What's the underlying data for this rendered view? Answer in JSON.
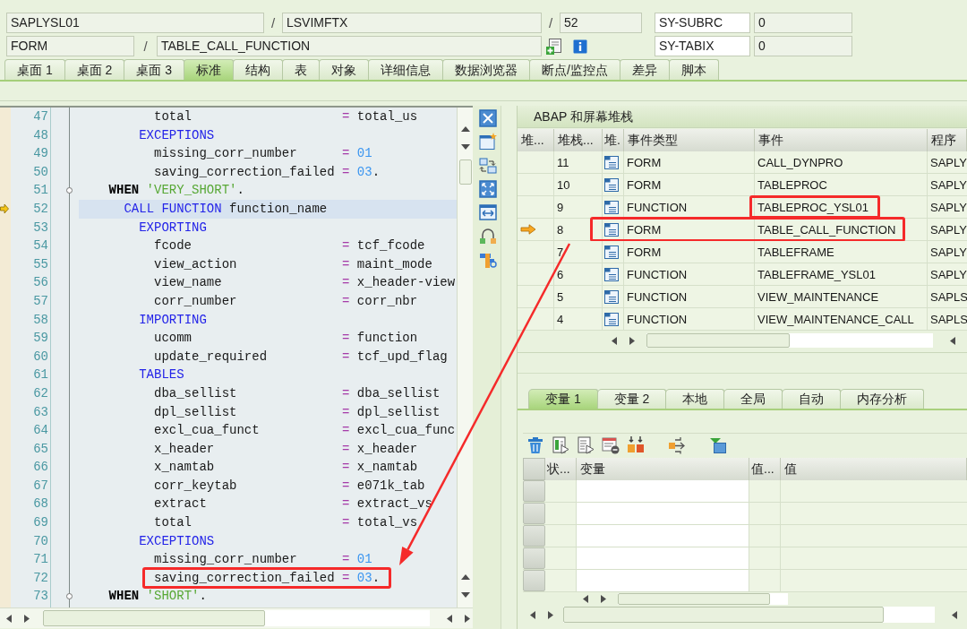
{
  "header": {
    "row_1": [
      {
        "kind": "field",
        "text": "SAPLYSL01"
      },
      {
        "kind": "separator",
        "text": "/"
      },
      {
        "kind": "field",
        "text": "LSVIMFTX"
      },
      {
        "kind": "separator",
        "text": "/"
      },
      {
        "kind": "field",
        "text": "52"
      }
    ],
    "row_2": [
      {
        "kind": "field",
        "text": "FORM"
      },
      {
        "kind": "separator",
        "text": "/"
      },
      {
        "kind": "field",
        "text": "TABLE_CALL_FUNCTION"
      }
    ],
    "system_fields": [
      {
        "name": "SY-SUBRC",
        "value": "0"
      },
      {
        "name": "SY-TABIX",
        "value": "0"
      }
    ]
  },
  "tabs": [
    {
      "label": "桌面 1",
      "selected": false
    },
    {
      "label": "桌面 2",
      "selected": false
    },
    {
      "label": "桌面 3",
      "selected": false
    },
    {
      "label": "标准",
      "selected": true
    },
    {
      "label": "结构",
      "selected": false
    },
    {
      "label": "表",
      "selected": false
    },
    {
      "label": "对象",
      "selected": false
    },
    {
      "label": "详细信息",
      "selected": false
    },
    {
      "label": "数据浏览器",
      "selected": false
    },
    {
      "label": "断点/监控点",
      "selected": false
    },
    {
      "label": "差异",
      "selected": false
    },
    {
      "label": "脚本",
      "selected": false
    }
  ],
  "code_editor": {
    "lines": [
      {
        "number": "47",
        "current": false,
        "fold": false,
        "annotated": false,
        "segments": [
          {
            "kind": "plain",
            "text": "          total                    "
          },
          {
            "kind": "operator",
            "text": "="
          },
          {
            "kind": "plain",
            "text": " total_us"
          }
        ]
      },
      {
        "number": "48",
        "current": false,
        "fold": false,
        "annotated": false,
        "segments": [
          {
            "kind": "keyword",
            "text": "        EXCEPTIONS"
          }
        ]
      },
      {
        "number": "49",
        "current": false,
        "fold": false,
        "annotated": false,
        "segments": [
          {
            "kind": "plain",
            "text": "          missing_corr_number      "
          },
          {
            "kind": "operator",
            "text": "="
          },
          {
            "kind": "number",
            "text": " 01"
          }
        ]
      },
      {
        "number": "50",
        "current": false,
        "fold": false,
        "annotated": false,
        "segments": [
          {
            "kind": "plain",
            "text": "          saving_correction_failed "
          },
          {
            "kind": "operator",
            "text": "="
          },
          {
            "kind": "number",
            "text": " 03"
          },
          {
            "kind": "plain",
            "text": "."
          }
        ]
      },
      {
        "number": "51",
        "current": false,
        "fold": true,
        "annotated": false,
        "segments": [
          {
            "kind": "bold",
            "text": "    WHEN"
          },
          {
            "kind": "string",
            "text": " 'VERY_SHORT'"
          },
          {
            "kind": "plain",
            "text": "."
          }
        ]
      },
      {
        "number": "52",
        "current": true,
        "fold": false,
        "annotated": false,
        "segments": [
          {
            "kind": "keyword",
            "text": "      CALL FUNCTION"
          },
          {
            "kind": "plain",
            "text": " function_name"
          }
        ]
      },
      {
        "number": "53",
        "current": false,
        "fold": false,
        "annotated": false,
        "segments": [
          {
            "kind": "keyword",
            "text": "        EXPORTING"
          }
        ]
      },
      {
        "number": "54",
        "current": false,
        "fold": false,
        "annotated": false,
        "segments": [
          {
            "kind": "plain",
            "text": "          fcode                    "
          },
          {
            "kind": "operator",
            "text": "="
          },
          {
            "kind": "plain",
            "text": " tcf_fcode"
          }
        ]
      },
      {
        "number": "55",
        "current": false,
        "fold": false,
        "annotated": false,
        "segments": [
          {
            "kind": "plain",
            "text": "          view_action              "
          },
          {
            "kind": "operator",
            "text": "="
          },
          {
            "kind": "plain",
            "text": " maint_mode"
          }
        ]
      },
      {
        "number": "56",
        "current": false,
        "fold": false,
        "annotated": false,
        "segments": [
          {
            "kind": "plain",
            "text": "          view_name                "
          },
          {
            "kind": "operator",
            "text": "="
          },
          {
            "kind": "plain",
            "text": " x_header-view"
          }
        ]
      },
      {
        "number": "57",
        "current": false,
        "fold": false,
        "annotated": false,
        "segments": [
          {
            "kind": "plain",
            "text": "          corr_number              "
          },
          {
            "kind": "operator",
            "text": "="
          },
          {
            "kind": "plain",
            "text": " corr_nbr"
          }
        ]
      },
      {
        "number": "58",
        "current": false,
        "fold": false,
        "annotated": false,
        "segments": [
          {
            "kind": "keyword",
            "text": "        IMPORTING"
          }
        ]
      },
      {
        "number": "59",
        "current": false,
        "fold": false,
        "annotated": false,
        "segments": [
          {
            "kind": "plain",
            "text": "          ucomm                    "
          },
          {
            "kind": "operator",
            "text": "="
          },
          {
            "kind": "plain",
            "text": " function"
          }
        ]
      },
      {
        "number": "60",
        "current": false,
        "fold": false,
        "annotated": false,
        "segments": [
          {
            "kind": "plain",
            "text": "          update_required          "
          },
          {
            "kind": "operator",
            "text": "="
          },
          {
            "kind": "plain",
            "text": " tcf_upd_flag"
          }
        ]
      },
      {
        "number": "61",
        "current": false,
        "fold": false,
        "annotated": false,
        "segments": [
          {
            "kind": "keyword",
            "text": "        TABLES"
          }
        ]
      },
      {
        "number": "62",
        "current": false,
        "fold": false,
        "annotated": false,
        "segments": [
          {
            "kind": "plain",
            "text": "          dba_sellist              "
          },
          {
            "kind": "operator",
            "text": "="
          },
          {
            "kind": "plain",
            "text": " dba_sellist"
          }
        ]
      },
      {
        "number": "63",
        "current": false,
        "fold": false,
        "annotated": false,
        "segments": [
          {
            "kind": "plain",
            "text": "          dpl_sellist              "
          },
          {
            "kind": "operator",
            "text": "="
          },
          {
            "kind": "plain",
            "text": " dpl_sellist"
          }
        ]
      },
      {
        "number": "64",
        "current": false,
        "fold": false,
        "annotated": false,
        "segments": [
          {
            "kind": "plain",
            "text": "          excl_cua_funct           "
          },
          {
            "kind": "operator",
            "text": "="
          },
          {
            "kind": "plain",
            "text": " excl_cua_func"
          }
        ]
      },
      {
        "number": "65",
        "current": false,
        "fold": false,
        "annotated": false,
        "segments": [
          {
            "kind": "plain",
            "text": "          x_header                 "
          },
          {
            "kind": "operator",
            "text": "="
          },
          {
            "kind": "plain",
            "text": " x_header"
          }
        ]
      },
      {
        "number": "66",
        "current": false,
        "fold": false,
        "annotated": false,
        "segments": [
          {
            "kind": "plain",
            "text": "          x_namtab                 "
          },
          {
            "kind": "operator",
            "text": "="
          },
          {
            "kind": "plain",
            "text": " x_namtab"
          }
        ]
      },
      {
        "number": "67",
        "current": false,
        "fold": false,
        "annotated": false,
        "segments": [
          {
            "kind": "plain",
            "text": "          corr_keytab              "
          },
          {
            "kind": "operator",
            "text": "="
          },
          {
            "kind": "plain",
            "text": " e071k_tab"
          }
        ]
      },
      {
        "number": "68",
        "current": false,
        "fold": false,
        "annotated": false,
        "segments": [
          {
            "kind": "plain",
            "text": "          extract                  "
          },
          {
            "kind": "operator",
            "text": "="
          },
          {
            "kind": "plain",
            "text": " extract_vs"
          }
        ]
      },
      {
        "number": "69",
        "current": false,
        "fold": false,
        "annotated": false,
        "segments": [
          {
            "kind": "plain",
            "text": "          total                    "
          },
          {
            "kind": "operator",
            "text": "="
          },
          {
            "kind": "plain",
            "text": " total_vs"
          }
        ]
      },
      {
        "number": "70",
        "current": false,
        "fold": false,
        "annotated": false,
        "segments": [
          {
            "kind": "keyword",
            "text": "        EXCEPTIONS"
          }
        ]
      },
      {
        "number": "71",
        "current": false,
        "fold": false,
        "annotated": false,
        "segments": [
          {
            "kind": "plain",
            "text": "          missing_corr_number      "
          },
          {
            "kind": "operator",
            "text": "="
          },
          {
            "kind": "number",
            "text": " 01"
          }
        ]
      },
      {
        "number": "72",
        "current": false,
        "fold": false,
        "annotated": true,
        "segments": [
          {
            "kind": "plain",
            "text": "          saving_correction_failed "
          },
          {
            "kind": "operator",
            "text": "="
          },
          {
            "kind": "number",
            "text": " 03"
          },
          {
            "kind": "plain",
            "text": "."
          }
        ]
      },
      {
        "number": "73",
        "current": false,
        "fold": true,
        "annotated": false,
        "segments": [
          {
            "kind": "bold",
            "text": "    WHEN"
          },
          {
            "kind": "string",
            "text": " 'SHORT'"
          },
          {
            "kind": "plain",
            "text": "."
          }
        ]
      }
    ]
  },
  "stack_panel": {
    "title": "ABAP 和屏幕堆栈",
    "columns": [
      "堆...",
      "堆栈...",
      "堆.",
      "事件类型",
      "事件",
      "程序"
    ],
    "rows": [
      {
        "current": false,
        "type_annotated": false,
        "event_annotated": false,
        "number": "11",
        "type": "FORM",
        "event": "CALL_DYNPRO",
        "program": "SAPLY"
      },
      {
        "current": false,
        "type_annotated": false,
        "event_annotated": false,
        "number": "10",
        "type": "FORM",
        "event": "TABLEPROC",
        "program": "SAPLY"
      },
      {
        "current": false,
        "type_annotated": false,
        "event_annotated": true,
        "number": "9",
        "type": "FUNCTION",
        "event": "TABLEPROC_YSL01",
        "program": "SAPLY"
      },
      {
        "current": true,
        "type_annotated": true,
        "event_annotated": true,
        "number": "8",
        "type": "FORM",
        "event": "TABLE_CALL_FUNCTION",
        "program": "SAPLY"
      },
      {
        "current": false,
        "type_annotated": false,
        "event_annotated": false,
        "number": "7",
        "type": "FORM",
        "event": "TABLEFRAME",
        "program": "SAPLY"
      },
      {
        "current": false,
        "type_annotated": false,
        "event_annotated": false,
        "number": "6",
        "type": "FUNCTION",
        "event": "TABLEFRAME_YSL01",
        "program": "SAPLY"
      },
      {
        "current": false,
        "type_annotated": false,
        "event_annotated": false,
        "number": "5",
        "type": "FUNCTION",
        "event": "VIEW_MAINTENANCE",
        "program": "SAPLS"
      },
      {
        "current": false,
        "type_annotated": false,
        "event_annotated": false,
        "number": "4",
        "type": "FUNCTION",
        "event": "VIEW_MAINTENANCE_CALL",
        "program": "SAPLS"
      }
    ]
  },
  "variables_panel": {
    "tabs": [
      {
        "label": "变量 1",
        "selected": true
      },
      {
        "label": "变量 2",
        "selected": false
      },
      {
        "label": "本地",
        "selected": false
      },
      {
        "label": "全局",
        "selected": false
      },
      {
        "label": "自动",
        "selected": false
      },
      {
        "label": "内存分析",
        "selected": false
      }
    ],
    "columns": [
      "状...",
      "变量",
      "值...",
      "值"
    ]
  }
}
